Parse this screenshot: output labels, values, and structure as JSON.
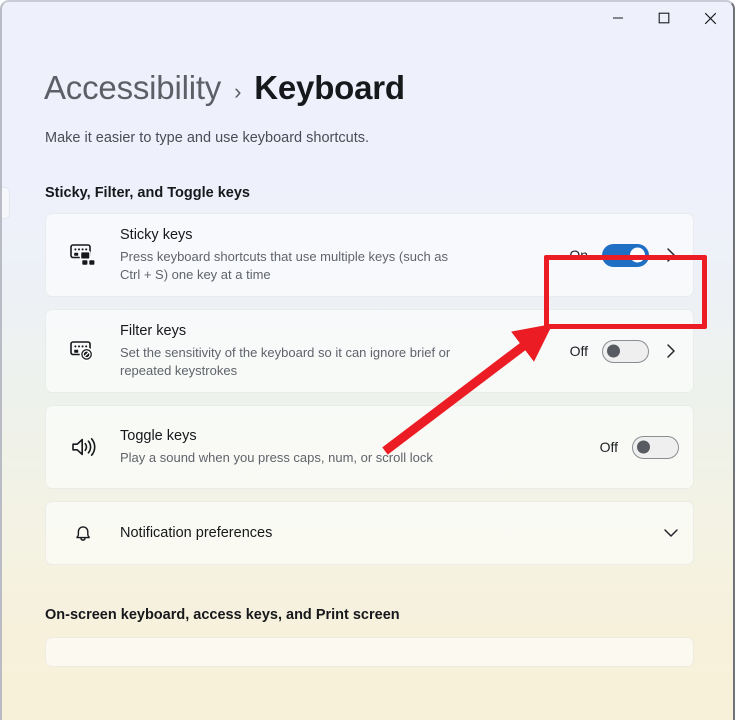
{
  "window": {
    "controls": [
      {
        "name": "minimize",
        "glyph": "minimize-icon"
      },
      {
        "name": "maximize",
        "glyph": "maximize-icon"
      },
      {
        "name": "close",
        "glyph": "close-icon"
      }
    ]
  },
  "header": {
    "breadcrumb_root": "Accessibility",
    "breadcrumb_separator": "›",
    "breadcrumb_current": "Keyboard",
    "subtitle": "Make it easier to type and use keyboard shortcuts."
  },
  "sections": [
    {
      "heading": "Sticky, Filter, and Toggle keys",
      "cards": [
        {
          "icon": "sticky-keys-icon",
          "title": "Sticky keys",
          "description": "Press keyboard shortcuts that use multiple keys (such as Ctrl + S) one key at a time",
          "state_label": "On",
          "toggle_state": "on",
          "has_chevron": true,
          "highlighted": true
        },
        {
          "icon": "filter-keys-icon",
          "title": "Filter keys",
          "description": "Set the sensitivity of the keyboard so it can ignore brief or repeated keystrokes",
          "state_label": "Off",
          "toggle_state": "off",
          "has_chevron": true,
          "highlighted": false
        },
        {
          "icon": "toggle-keys-sound-icon",
          "title": "Toggle keys",
          "description": "Play a sound when you press caps, num, or scroll lock",
          "state_label": "Off",
          "toggle_state": "off",
          "has_chevron": false,
          "highlighted": false
        },
        {
          "icon": "bell-icon",
          "title": "Notification preferences",
          "description": "",
          "state_label": "",
          "toggle_state": "none",
          "has_chevron": false,
          "has_expander": true,
          "highlighted": false
        }
      ]
    },
    {
      "heading": "On-screen keyboard, access keys, and Print screen",
      "cards": []
    }
  ],
  "annotations": {
    "highlight_box_color": "#ec1c24",
    "arrow_color": "#ec1c24"
  },
  "colors": {
    "toggle_on": "#1f6fc4",
    "toggle_off_knob": "#575a60",
    "background_top": "#eef1fb",
    "background_bottom": "#f8f1d9",
    "title_text": "#16181c",
    "muted_text": "#60636b"
  }
}
